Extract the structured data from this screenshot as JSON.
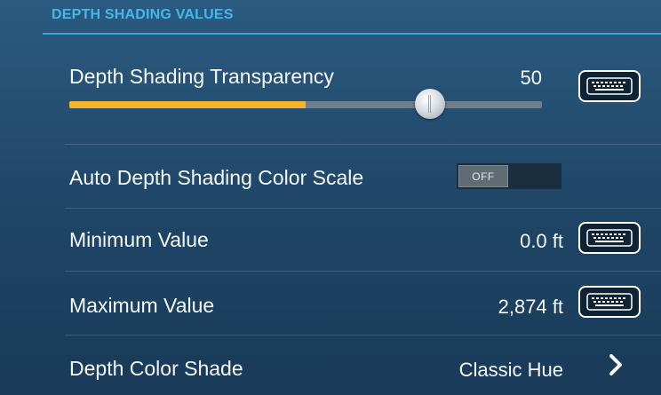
{
  "section": {
    "title": "DEPTH SHADING VALUES"
  },
  "rows": {
    "transparency": {
      "label": "Depth Shading Transparency",
      "value": "50",
      "slider_percent": 50
    },
    "auto_scale": {
      "label": "Auto Depth Shading Color Scale",
      "toggle_state": "OFF"
    },
    "minimum": {
      "label": "Minimum Value",
      "value": "0.0 ft"
    },
    "maximum": {
      "label": "Maximum Value",
      "value": "2,874 ft"
    },
    "color_shade": {
      "label": "Depth Color Shade",
      "value": "Classic Hue"
    }
  },
  "icons": {
    "keyboard": "keyboard-icon",
    "chevron": "chevron-right-icon"
  },
  "colors": {
    "accent": "#45b8ea",
    "slider_fill": "#f5b52a",
    "background_top": "#2b5a80",
    "background_bottom": "#193a58"
  }
}
